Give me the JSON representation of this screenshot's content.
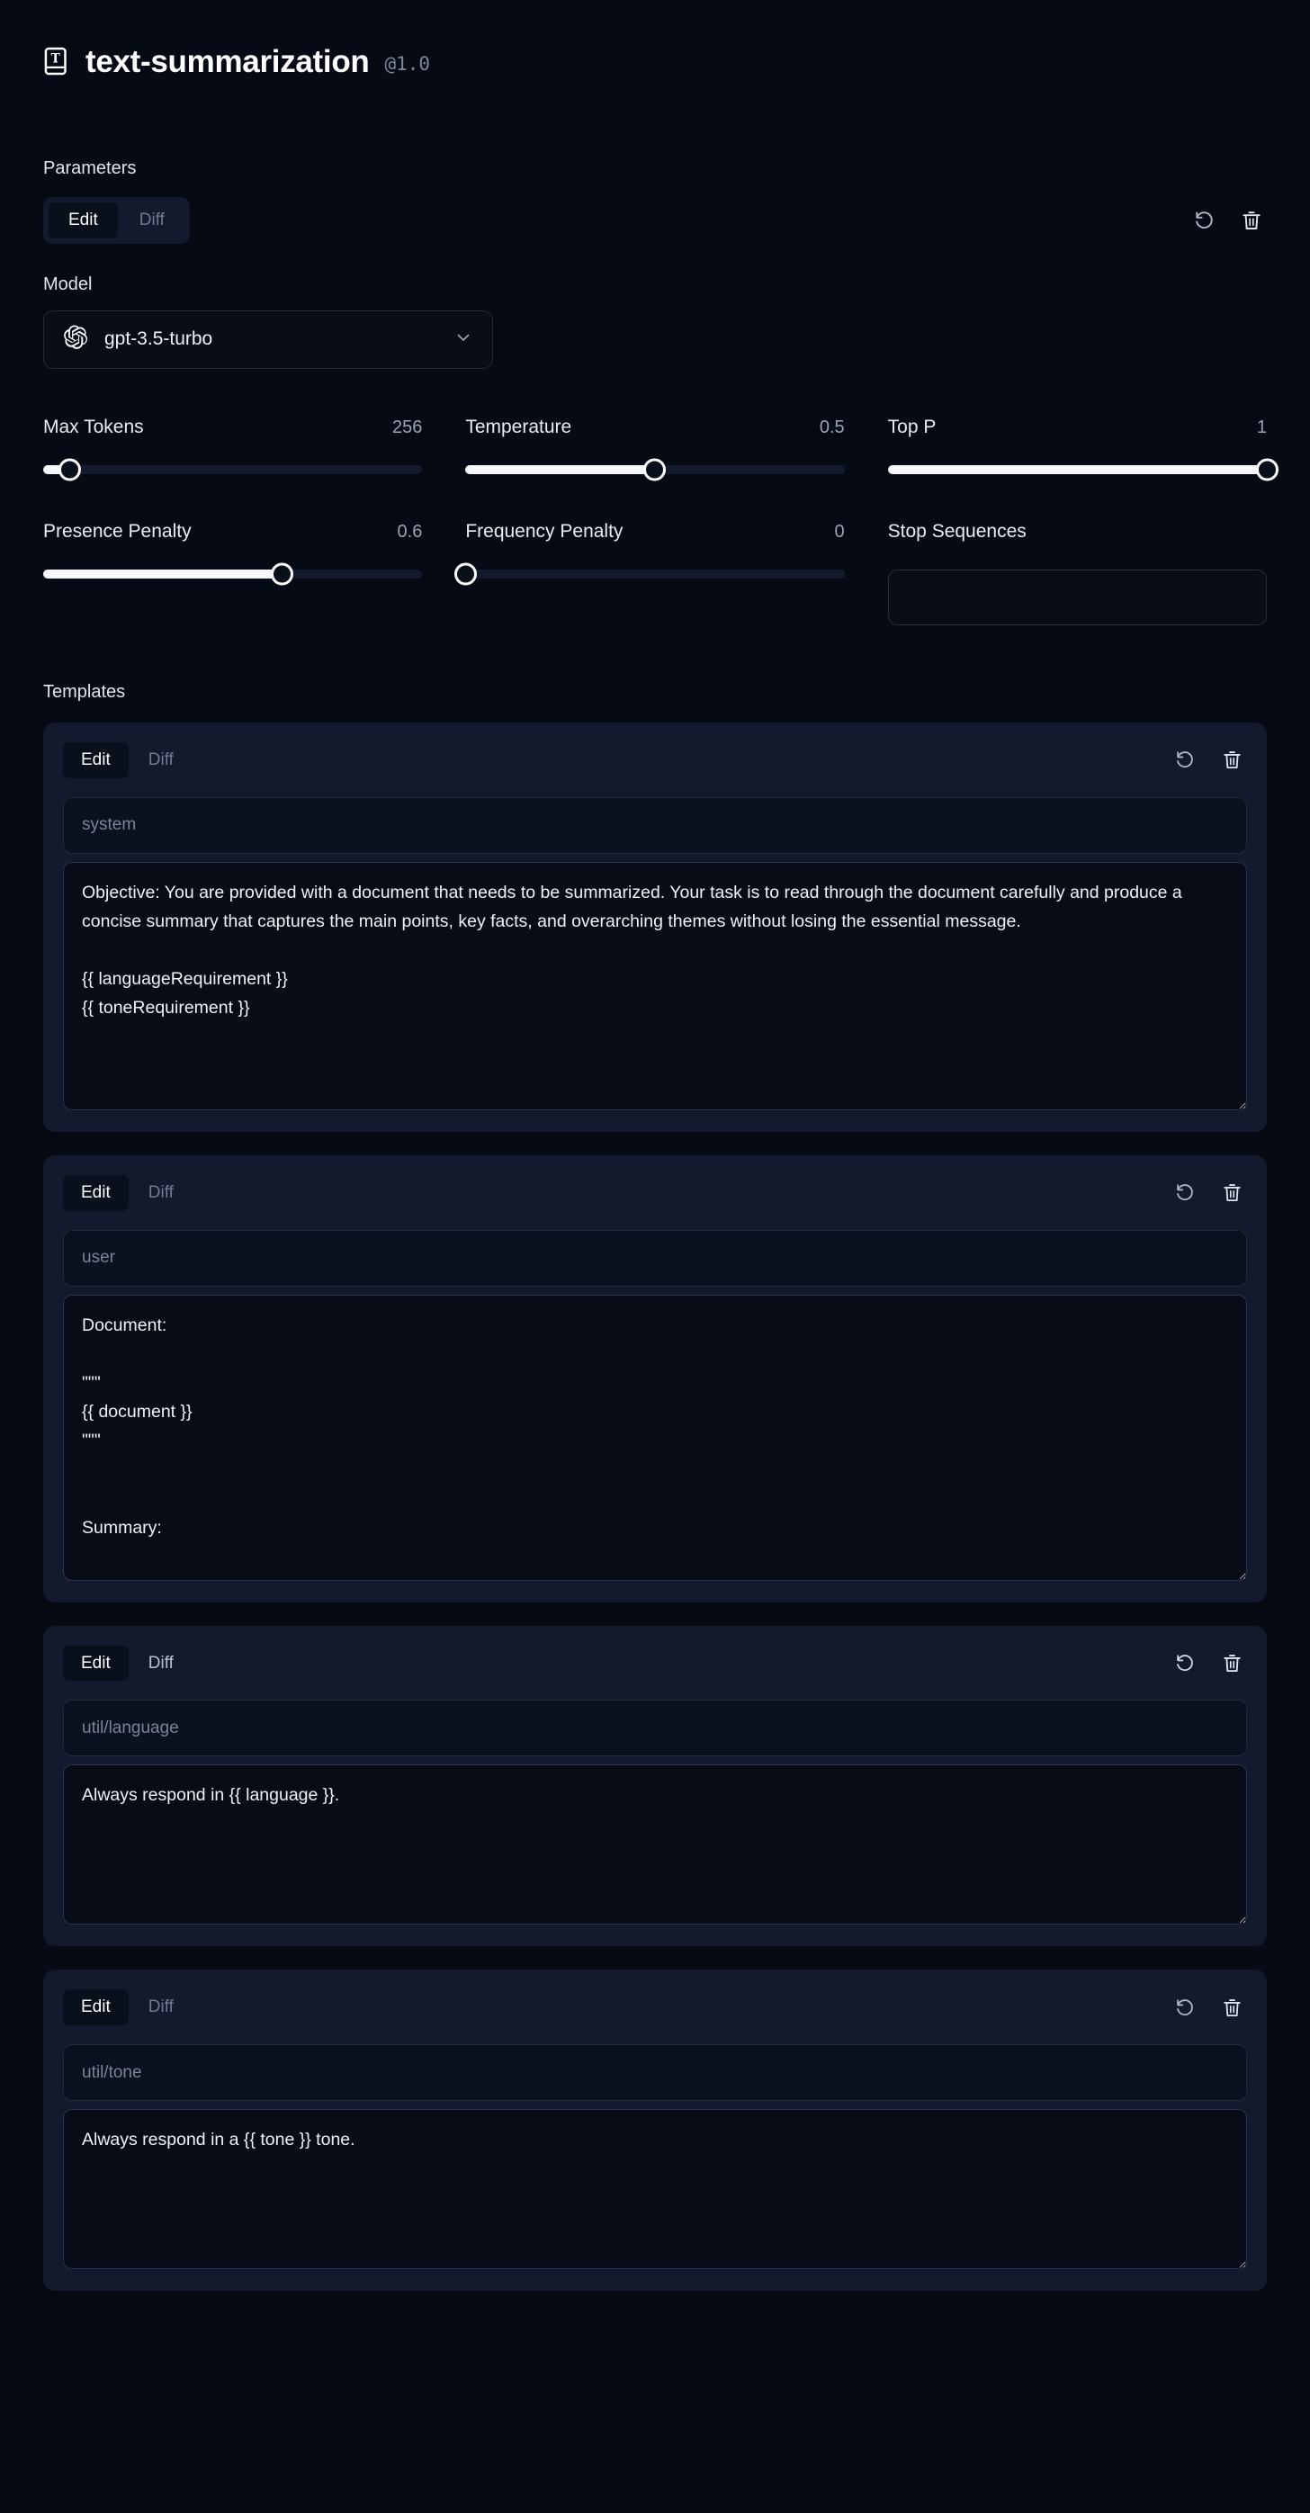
{
  "header": {
    "icon": "book-text-icon",
    "title": "text-summarization",
    "version": "@1.0"
  },
  "parameters": {
    "section_label": "Parameters",
    "tabs": {
      "edit": "Edit",
      "diff": "Diff",
      "active": "Edit"
    },
    "actions": {
      "reset": "reset-icon",
      "delete": "trash-icon"
    },
    "model": {
      "label": "Model",
      "provider_icon": "openai-logo-icon",
      "value": "gpt-3.5-turbo",
      "chevron": "chevron-down-icon"
    },
    "sliders": [
      {
        "name": "Max Tokens",
        "value": "256",
        "percent": 7
      },
      {
        "name": "Temperature",
        "value": "0.5",
        "percent": 50
      },
      {
        "name": "Top P",
        "value": "1",
        "percent": 100
      },
      {
        "name": "Presence Penalty",
        "value": "0.6",
        "percent": 63
      },
      {
        "name": "Frequency Penalty",
        "value": "0",
        "percent": 0
      }
    ],
    "stop_sequences": {
      "label": "Stop Sequences",
      "value": "",
      "placeholder": ""
    }
  },
  "templates": {
    "section_label": "Templates",
    "tabs": {
      "edit": "Edit",
      "diff": "Diff"
    },
    "actions": {
      "reset": "reset-icon",
      "delete": "trash-icon"
    },
    "items": [
      {
        "active_tab": "Edit",
        "role_placeholder": "system",
        "role_value": "",
        "content": "Objective: You are provided with a document that needs to be summarized. Your task is to read through the document carefully and produce a concise summary that captures the main points, key facts, and overarching themes without losing the essential message.\n\n{{ languageRequirement }}\n{{ toneRequirement }}"
      },
      {
        "active_tab": "Edit",
        "role_placeholder": "user",
        "role_value": "",
        "content": "Document:\n\n\"\"\"\n{{ document }}\n\"\"\"\n\n\nSummary:"
      },
      {
        "active_tab": "Edit",
        "role_placeholder": "util/language",
        "role_value": "",
        "content": "Always respond in {{ language }}."
      },
      {
        "active_tab": "Edit",
        "role_placeholder": "util/tone",
        "role_value": "",
        "content": "Always respond in a {{ tone }} tone."
      }
    ]
  },
  "colors": {
    "page_bg": "#050a14",
    "card_bg": "#141a2e",
    "input_bg": "#070c17",
    "text": "#e9edf5",
    "muted": "#7d8799",
    "accent": "#f5f7fb"
  }
}
